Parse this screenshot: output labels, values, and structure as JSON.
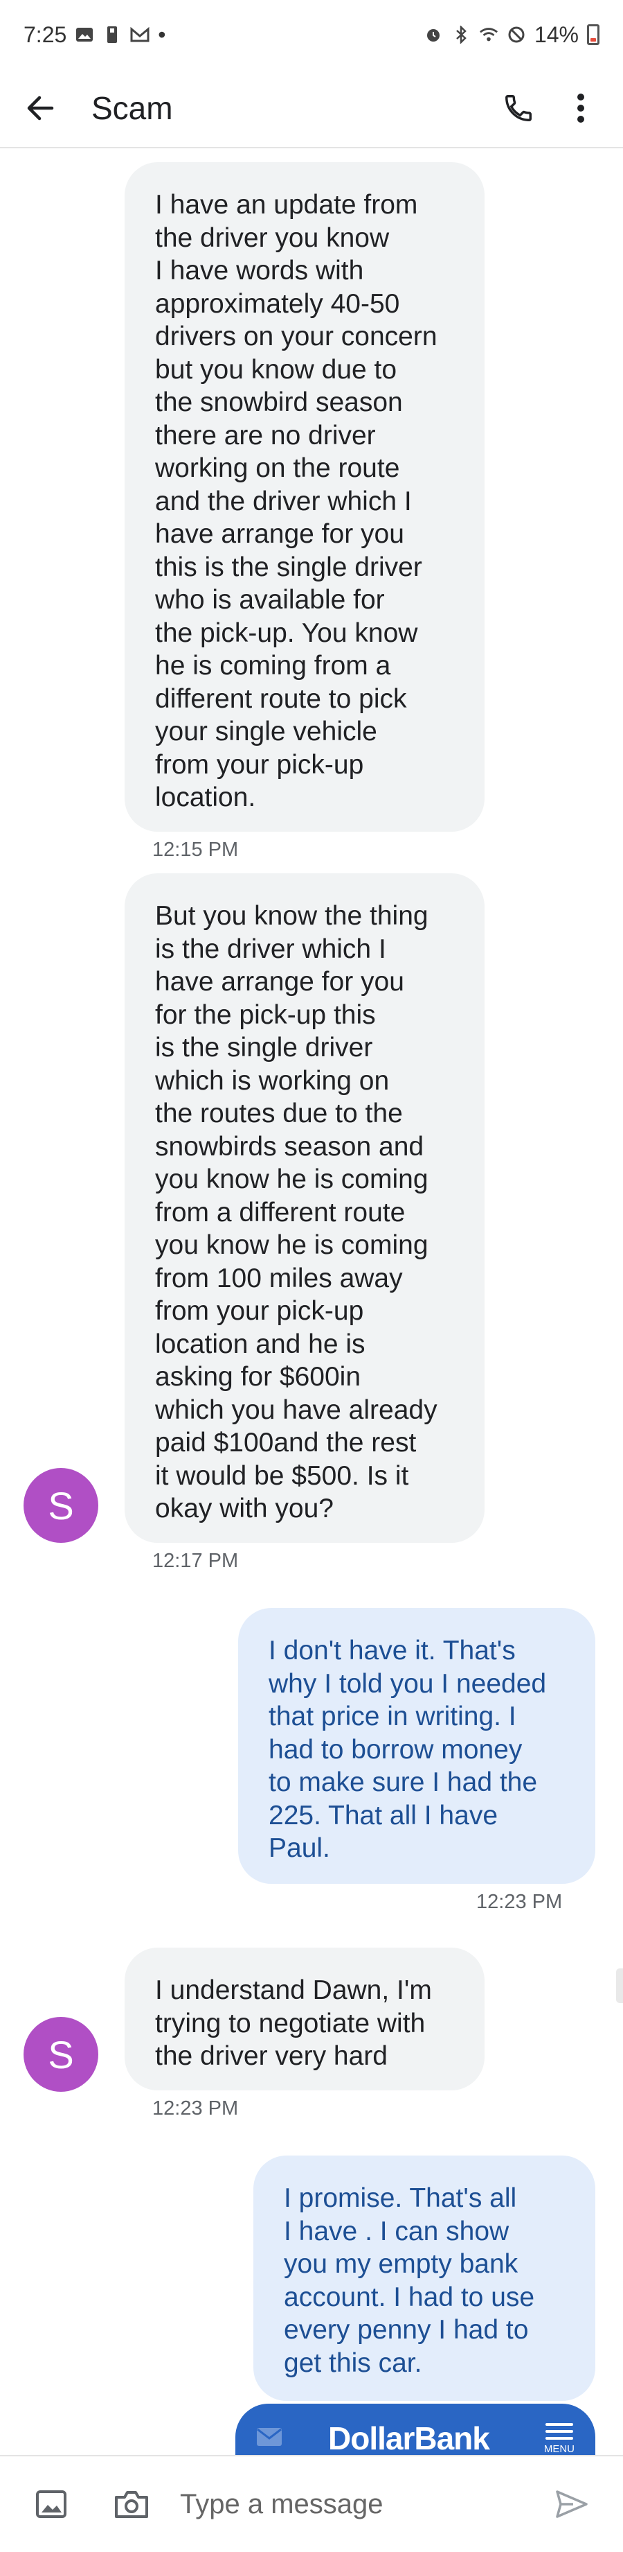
{
  "status_bar": {
    "time": "7:25",
    "dot": "•",
    "battery_percent": "14%"
  },
  "header": {
    "title": "Scam"
  },
  "messages": [
    {
      "direction": "incoming",
      "text": "I have an update from\nthe driver you know\nI have words with\napproximately 40-50\ndrivers on your concern\nbut you know due to\nthe snowbird season\nthere are no driver\nworking on the route\nand the driver which I\nhave arrange for you\nthis is the single driver\nwho is available for\nthe pick-up. You know\nhe is coming from a\ndifferent route to pick\nyour single vehicle\nfrom your pick-up\nlocation.",
      "time": "12:15 PM"
    },
    {
      "direction": "incoming",
      "text": "But you know the thing\nis the driver which I\nhave arrange for you\nfor the pick-up this\nis the single driver\nwhich is working on\nthe routes due to the\nsnowbirds season and\nyou know he is coming\nfrom a different route\nyou know he is coming\nfrom 100 miles away\nfrom your pick-up\nlocation and he is\nasking for $600in\nwhich you have already\npaid $100and the rest\nit would be $500. Is it\nokay with you?",
      "time": "12:17 PM",
      "avatar": "S"
    },
    {
      "direction": "outgoing",
      "text": "I don't have it. That's\nwhy I told you I needed\nthat price in writing. I\nhad to borrow money\nto make sure I had the\n225. That all I have\nPaul.",
      "time": "12:23 PM"
    },
    {
      "direction": "incoming",
      "text": "I understand Dawn, I'm\ntrying to negotiate with\nthe driver very hard",
      "time": "12:23 PM",
      "avatar": "S"
    },
    {
      "direction": "outgoing",
      "text": "I promise. That's all\nI have . I can show\nyou my empty bank\naccount.  I had to use\nevery penny I had to\nget this car."
    }
  ],
  "card": {
    "logo": "DollarBank",
    "menu_label": "MENU"
  },
  "composer": {
    "placeholder": "Type a message"
  },
  "icons": [
    "image-icon",
    "email-icon",
    "usb-icon",
    "gmail-icon",
    "alarm-icon",
    "bluetooth-icon",
    "wifi-icon",
    "dnd-icon",
    "battery-icon",
    "back-arrow-icon",
    "phone-icon",
    "more-vert-icon",
    "mail-icon",
    "menu-icon",
    "gallery-icon",
    "camera-icon",
    "send-icon"
  ],
  "colors": {
    "avatar": "#b04fc5",
    "incoming_bubble": "#f1f3f4",
    "outgoing_bubble": "#e3edfb",
    "outgoing_text": "#1d4f94",
    "card": "#2a66c4",
    "battery_low": "#e74c3c"
  }
}
